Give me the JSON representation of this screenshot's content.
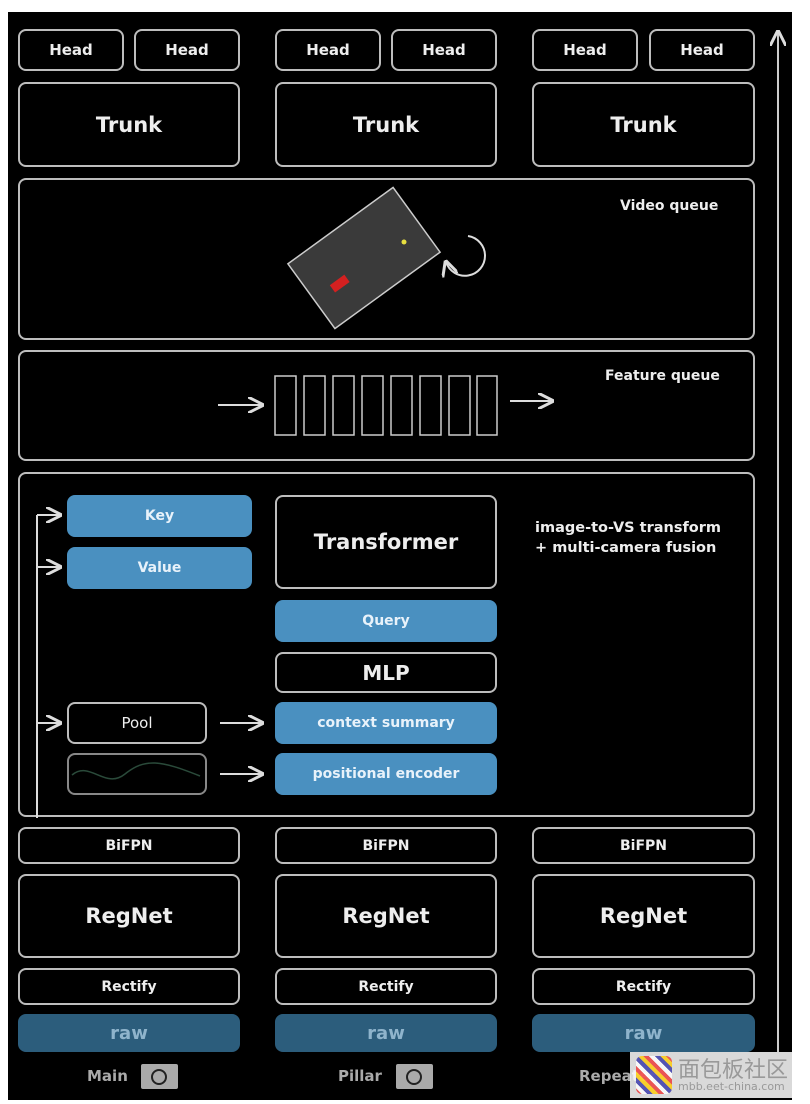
{
  "heads": [
    "Head",
    "Head",
    "Head",
    "Head",
    "Head",
    "Head"
  ],
  "trunks": [
    "Trunk",
    "Trunk",
    "Trunk"
  ],
  "video_queue": {
    "label": "Video queue"
  },
  "feature_queue": {
    "label": "Feature queue"
  },
  "fusion": {
    "caption_line1": "image-to-VS transform",
    "caption_line2": "+ multi-camera fusion",
    "key": "Key",
    "value": "Value",
    "transformer": "Transformer",
    "query": "Query",
    "mlp": "MLP",
    "pool": "Pool",
    "context_summary": "context summary",
    "positional_encoder": "positional encoder"
  },
  "columns": [
    {
      "bifpn": "BiFPN",
      "regnet": "RegNet",
      "rectify": "Rectify",
      "raw": "raw",
      "camera": "Main"
    },
    {
      "bifpn": "BiFPN",
      "regnet": "RegNet",
      "rectify": "Rectify",
      "raw": "raw",
      "camera": "Pillar"
    },
    {
      "bifpn": "BiFPN",
      "regnet": "RegNet",
      "rectify": "Rectify",
      "raw": "raw",
      "camera": "Repeater"
    }
  ],
  "watermark": {
    "text": "面包板社区",
    "url": "mbb.eet-china.com"
  },
  "colors": {
    "blue_block": "#4a90c0",
    "raw_block": "#2c5d7c",
    "car": "#d42020",
    "dot": "#e8e040"
  }
}
